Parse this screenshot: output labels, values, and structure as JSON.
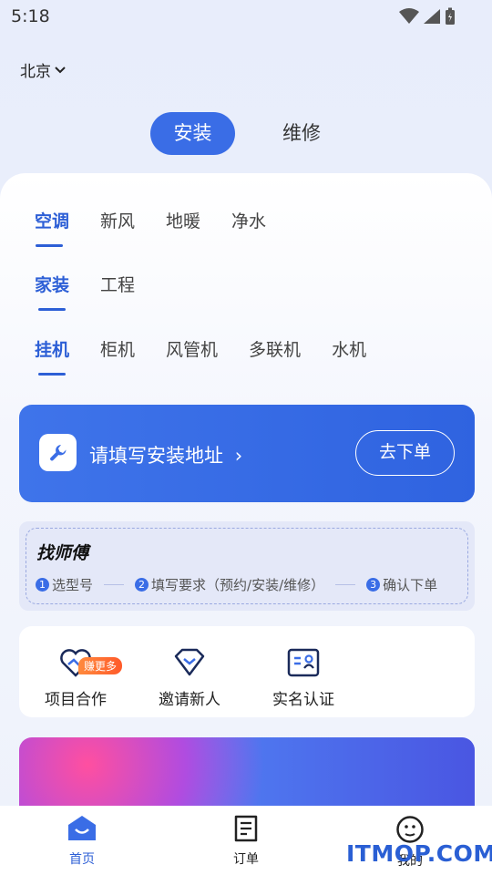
{
  "status_bar": {
    "time": "5:18"
  },
  "location": {
    "city": "北京"
  },
  "mode_tabs": [
    {
      "label": "安装",
      "active": true
    },
    {
      "label": "维修",
      "active": false
    }
  ],
  "category_tabs": [
    "空调",
    "新风",
    "地暖",
    "净水"
  ],
  "type_tabs": [
    "家装",
    "工程"
  ],
  "unit_tabs": [
    "挂机",
    "柜机",
    "风管机",
    "多联机",
    "水机"
  ],
  "address_card": {
    "prompt": "请填写安装地址",
    "arrow": "›",
    "button": "去下单"
  },
  "steps": {
    "title": "找师傅",
    "items": [
      {
        "num": "1",
        "text": "选型号"
      },
      {
        "num": "2",
        "text": "填写要求（预约/安装/维修）"
      },
      {
        "num": "3",
        "text": "确认下单"
      }
    ]
  },
  "quick_actions": [
    {
      "label": "项目合作",
      "icon": "handshake-heart-icon",
      "badge": "赚更多"
    },
    {
      "label": "邀请新人",
      "icon": "diamond-icon"
    },
    {
      "label": "实名认证",
      "icon": "id-card-icon"
    }
  ],
  "bottom_nav": [
    {
      "label": "首页",
      "icon": "home-icon",
      "active": true
    },
    {
      "label": "订单",
      "icon": "order-icon",
      "active": false
    },
    {
      "label": "我的",
      "icon": "profile-face-icon",
      "active": false
    }
  ],
  "watermark": "ITMOP.COM",
  "colors": {
    "accent": "#3a6de6",
    "card_blue": "#2f63e0",
    "badge_orange": "#ff6a30"
  }
}
